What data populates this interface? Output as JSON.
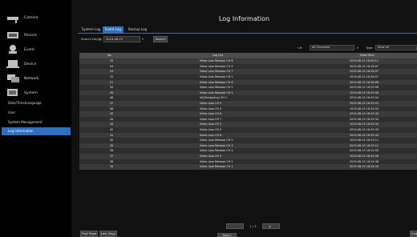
{
  "sidebar": {
    "items": [
      {
        "label": "Camera",
        "icon": "camera-icon"
      },
      {
        "label": "Record",
        "icon": "record-icon"
      },
      {
        "label": "Event",
        "icon": "event-icon"
      },
      {
        "label": "Device",
        "icon": "device-icon"
      },
      {
        "label": "Network",
        "icon": "network-icon"
      },
      {
        "label": "System",
        "icon": "system-icon"
      }
    ],
    "sub_items": [
      {
        "label": "Date/Time/Language"
      },
      {
        "label": "User"
      },
      {
        "label": "System Management"
      },
      {
        "label": "Log Information"
      }
    ]
  },
  "main": {
    "title": "Log Information",
    "tabs": [
      "System Log",
      "Event Log",
      "Backup Log"
    ],
    "search_label": "Search Day",
    "search_date": "2019-08-15",
    "search_button": "Search",
    "ch_label": "CH",
    "ch_value": "All Channels",
    "type_label": "Type",
    "type_value": "View all",
    "columns": [
      "No.",
      "Log List",
      "Date/Time"
    ],
    "rows": [
      {
        "no": "55",
        "log": "Video Loss Release CH 6",
        "dt": "2019-08-15 16:30:11"
      },
      {
        "no": "54",
        "log": "Video Loss Release CH 9",
        "dt": "2019-08-15 16:26:07"
      },
      {
        "no": "53",
        "log": "Video Loss Release CH 7",
        "dt": "2019-08-15 16:26:07"
      },
      {
        "no": "52",
        "log": "Video Loss Release CH 2",
        "dt": "2019-08-15 16:26:07"
      },
      {
        "no": "51",
        "log": "Video Loss Release CH 8",
        "dt": "2019-08-15 16:26:06"
      },
      {
        "no": "50",
        "log": "Video Loss Release CH 5",
        "dt": "2019-08-15 16:25:58"
      },
      {
        "no": "49",
        "log": "Video Loss Release CH 4",
        "dt": "2019-08-15 16:25:58"
      },
      {
        "no": "48",
        "log": "VA(Tampering) CH 1",
        "dt": "2019-08-15 16:25:54"
      },
      {
        "no": "47",
        "log": "Video Loss CH 5",
        "dt": "2019-08-15 16:25:53"
      },
      {
        "no": "46",
        "log": "Video Loss CH 4",
        "dt": "2019-08-15 16:25:53"
      },
      {
        "no": "45",
        "log": "Video Loss CH 8",
        "dt": "2019-08-15 16:25:34"
      },
      {
        "no": "44",
        "log": "Video Loss CH 7",
        "dt": "2019-08-15 16:25:34"
      },
      {
        "no": "43",
        "log": "Video Loss CH 2",
        "dt": "2019-08-15 16:25:34"
      },
      {
        "no": "42",
        "log": "Video Loss CH 9",
        "dt": "2019-08-15 16:25:33"
      },
      {
        "no": "41",
        "log": "Video Loss CH 6",
        "dt": "2019-08-15 16:25:33"
      },
      {
        "no": "40",
        "log": "Video Loss Release CH 5",
        "dt": "2019-08-15 16:25:11"
      },
      {
        "no": "39",
        "log": "Video Loss Release CH 3",
        "dt": "2019-08-15 16:25:11"
      },
      {
        "no": "38",
        "log": "Video Loss Release CH 4",
        "dt": "2019-08-15 16:25:00"
      },
      {
        "no": "37",
        "log": "Video Loss CH 3",
        "dt": "2019-08-15 16:24:58"
      },
      {
        "no": "36",
        "log": "Video Loss Release CH 2",
        "dt": "2019-08-15 16:24:38"
      },
      {
        "no": "35",
        "log": "Video Loss Release CH 1",
        "dt": "2019-08-15 16:24:33"
      }
    ],
    "page_indicator": "1 / 3",
    "first_page": "First Page",
    "last_page": "Last Page",
    "export": "Exp",
    "return": "Return"
  }
}
